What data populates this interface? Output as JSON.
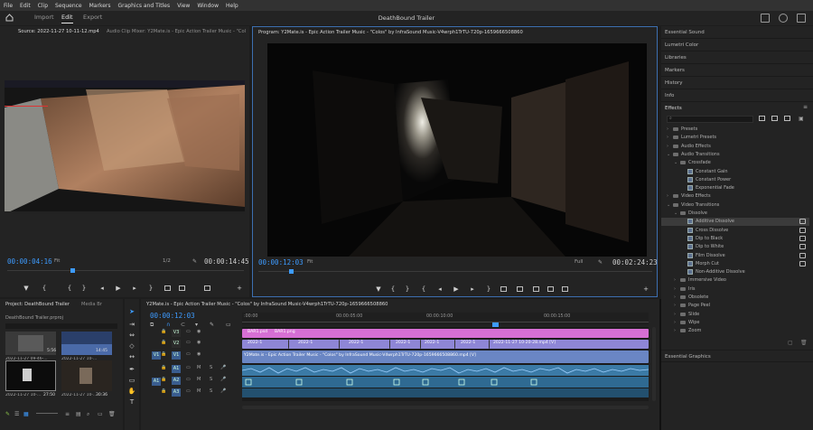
{
  "menu": [
    "File",
    "Edit",
    "Clip",
    "Sequence",
    "Markers",
    "Graphics and Titles",
    "View",
    "Window",
    "Help"
  ],
  "header": {
    "nav": [
      "Import",
      "Edit",
      "Export"
    ],
    "active_nav": "Edit",
    "project_title": "DeathBound Trailer"
  },
  "source_monitor": {
    "tabs": [
      "Source: 2022-11-27 10-11-12.mp4",
      "Audio Clip Mixer: Y2Mate.is - Epic Action Trailer Music - \"Col"
    ],
    "timecode": "00:00:04:16",
    "fit": "Fit",
    "resolution": "1/2",
    "duration": "00:00:14:45"
  },
  "program_monitor": {
    "tab": "Program: Y2Mate.is - Epic Action Trailer Music - \"Colos\" by InfraSound Music-V4wrph1TrTU-720p-1659666508860",
    "timecode": "00:00:12:03",
    "fit": "Fit",
    "quality": "Full",
    "duration": "00:02:24:23"
  },
  "right_panel": {
    "items": [
      "Essential Sound",
      "Lumetri Color",
      "Libraries",
      "Markers",
      "History",
      "Info"
    ],
    "effects_title": "Effects",
    "effects_tree": [
      {
        "label": "Presets",
        "level": 0,
        "type": "folder",
        "arrow": ">"
      },
      {
        "label": "Lumetri Presets",
        "level": 0,
        "type": "folder",
        "arrow": ">"
      },
      {
        "label": "Audio Effects",
        "level": 0,
        "type": "folder",
        "arrow": ">"
      },
      {
        "label": "Audio Transitions",
        "level": 0,
        "type": "folder",
        "arrow": "v"
      },
      {
        "label": "Crossfade",
        "level": 1,
        "type": "folder",
        "arrow": "v"
      },
      {
        "label": "Constant Gain",
        "level": 2,
        "type": "fx"
      },
      {
        "label": "Constant Power",
        "level": 2,
        "type": "fx"
      },
      {
        "label": "Exponential Fade",
        "level": 2,
        "type": "fx"
      },
      {
        "label": "Video Effects",
        "level": 0,
        "type": "folder",
        "arrow": ">"
      },
      {
        "label": "Video Transitions",
        "level": 0,
        "type": "folder",
        "arrow": "v"
      },
      {
        "label": "Dissolve",
        "level": 1,
        "type": "folder",
        "arrow": "v"
      },
      {
        "label": "Additive Dissolve",
        "level": 2,
        "type": "fx",
        "selected": true,
        "badge": true
      },
      {
        "label": "Cross Dissolve",
        "level": 2,
        "type": "fx",
        "badge": true
      },
      {
        "label": "Dip to Black",
        "level": 2,
        "type": "fx",
        "badge": true
      },
      {
        "label": "Dip to White",
        "level": 2,
        "type": "fx",
        "badge": true
      },
      {
        "label": "Film Dissolve",
        "level": 2,
        "type": "fx",
        "badge": true
      },
      {
        "label": "Morph Cut",
        "level": 2,
        "type": "fx",
        "badge": true
      },
      {
        "label": "Non-Additive Dissolve",
        "level": 2,
        "type": "fx"
      },
      {
        "label": "Immersive Video",
        "level": 1,
        "type": "folder",
        "arrow": ">"
      },
      {
        "label": "Iris",
        "level": 1,
        "type": "folder",
        "arrow": ">"
      },
      {
        "label": "Obsolete",
        "level": 1,
        "type": "folder",
        "arrow": ">"
      },
      {
        "label": "Page Peel",
        "level": 1,
        "type": "folder",
        "arrow": ">"
      },
      {
        "label": "Slide",
        "level": 1,
        "type": "folder",
        "arrow": ">"
      },
      {
        "label": "Wipe",
        "level": 1,
        "type": "folder",
        "arrow": ">"
      },
      {
        "label": "Zoom",
        "level": 1,
        "type": "folder",
        "arrow": ">"
      }
    ],
    "essential_graphics": "Essential Graphics"
  },
  "project": {
    "tabs": [
      "Project: DeathBound Trailer",
      "Media Br"
    ],
    "file": "DeathBound Trailer.prproj",
    "thumbs": [
      {
        "name": "2022-11-27 09-46-...",
        "dur": "5:56"
      },
      {
        "name": "2022-11-27 10-...",
        "dur": "14:45"
      },
      {
        "name": "2022-11-27 10-...",
        "dur": "27:50"
      },
      {
        "name": "2022-11-27 10-...",
        "dur": "30:36"
      }
    ]
  },
  "timeline": {
    "tab": "Y2Mate.is - Epic Action Trailer Music - \"Colos\" by InfraSound Music-V4wrph1TrTU-720p-1659666508860",
    "timecode": "00:00:12:03",
    "ruler": [
      ":00:00",
      "00:00:05:00",
      "00:00:10:00",
      "00:00:15:00"
    ],
    "tracks": [
      "V3",
      "V2",
      "V1",
      "A1",
      "A2",
      "A3"
    ],
    "source_patch": [
      "V1",
      "A1"
    ],
    "v3_clips": [
      "BAR1.psd",
      "BAR1.png"
    ],
    "v2_clips": [
      "2022-1",
      "2022-1",
      "2022-1",
      "2022-1",
      "2022-1",
      "2022-1",
      "2022-11-27 10-20-28.mp4 [V]"
    ],
    "v1_clip": "Y2Mate.is - Epic Action Trailer Music - \"Colos\" by InfraSound Music-V4wrph1TrTU-720p-1659666508860.mp4 [V]"
  },
  "colors": {
    "accent_blue": "#3d9bff",
    "v3_pink": "#d66fd4",
    "v2_purple": "#8e86d6",
    "v1_blue": "#6a86c4",
    "audio_teal": "#3b7aa6"
  }
}
